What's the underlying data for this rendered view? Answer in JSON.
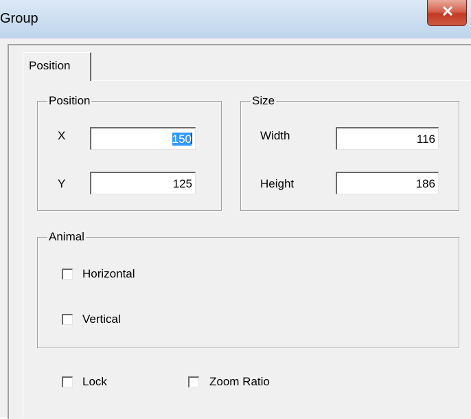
{
  "window": {
    "title": "Group",
    "close_icon": "close-icon"
  },
  "tabs": [
    {
      "label": "Position",
      "selected": true
    }
  ],
  "position_group": {
    "title": "Position",
    "x_label": "X",
    "x_value_selected": "150",
    "x_value_rest": "",
    "y_label": "Y",
    "y_value": "125"
  },
  "size_group": {
    "title": "Size",
    "width_label": "Width",
    "width_value": "116",
    "height_label": "Height",
    "height_value": "186"
  },
  "animal_group": {
    "title": "Animal",
    "horizontal_label": "Horizontal",
    "horizontal_checked": false,
    "vertical_label": "Vertical",
    "vertical_checked": false
  },
  "options": {
    "lock_label": "Lock",
    "lock_checked": false,
    "zoom_ratio_label": "Zoom Ratio",
    "zoom_ratio_checked": false
  },
  "colors": {
    "selection": "#3399ff",
    "face": "#f0f0f0",
    "close": "#c23a24"
  }
}
